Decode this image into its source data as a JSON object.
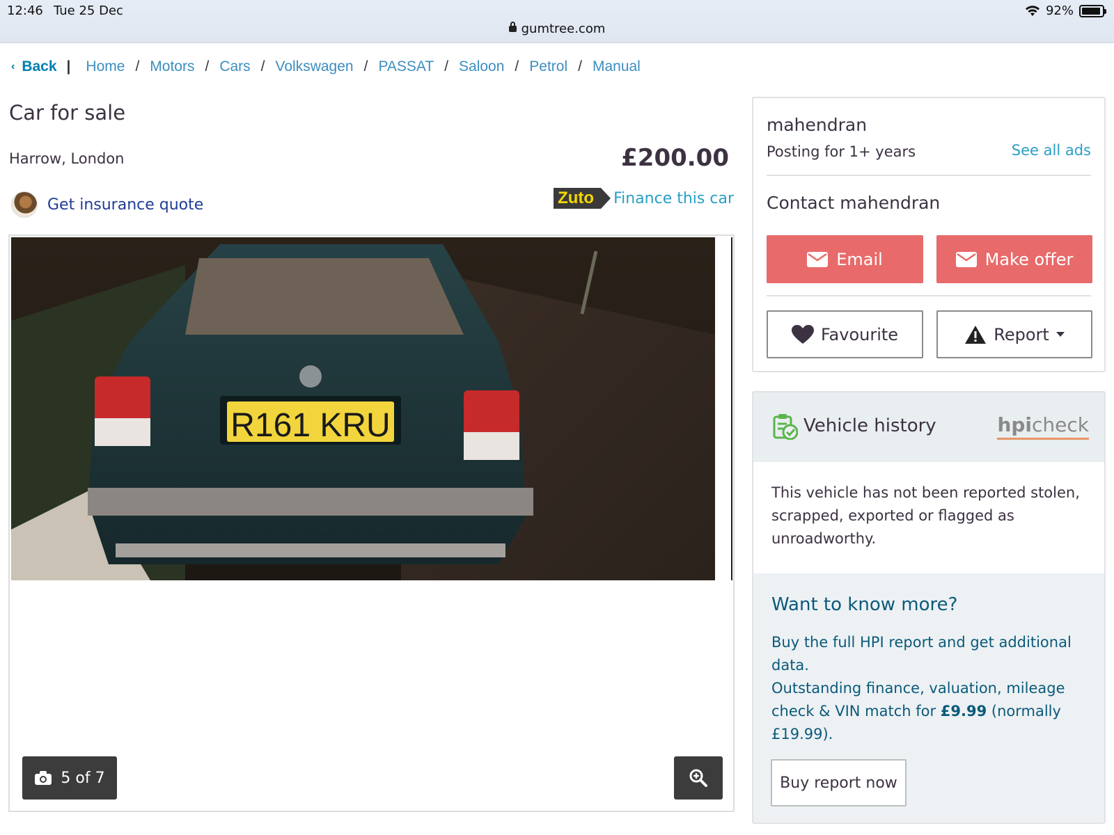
{
  "status_bar": {
    "time": "12:46",
    "date": "Tue 25 Dec",
    "battery_text": "92%",
    "battery_level": 0.92,
    "url": "gumtree.com"
  },
  "breadcrumb": {
    "back_label": "Back",
    "items": [
      "Home",
      "Motors",
      "Cars",
      "Volkswagen",
      "PASSAT",
      "Saloon",
      "Petrol",
      "Manual"
    ]
  },
  "listing": {
    "title": "Car for sale",
    "location": "Harrow, London",
    "price": "£200.00",
    "insurance_label": "Get insurance quote",
    "finance_brand": "Zuto",
    "finance_label": "Finance this car",
    "photo_counter": "5 of 7",
    "plate_text": "R161 KRU"
  },
  "seller": {
    "name": "mahendran",
    "posting_for": "Posting for 1+ years",
    "see_all_ads": "See all ads",
    "contact_heading": "Contact mahendran",
    "email_label": "Email",
    "make_offer_label": "Make offer",
    "favourite_label": "Favourite",
    "report_label": "Report"
  },
  "vehicle_history": {
    "title": "Vehicle history",
    "brand_bold": "hpi",
    "brand_light": "check",
    "status_text": "This vehicle has not been reported stolen, scrapped, exported or flagged as unroadworthy.",
    "more_title": "Want to know more?",
    "more_line1": "Buy the full HPI report and get additional data.",
    "more_line2_pre": "Outstanding finance, valuation, mileage check & VIN match for ",
    "more_price": "£9.99",
    "more_line2_post": " (normally £19.99).",
    "buy_label": "Buy report now"
  },
  "colors": {
    "link": "#2a9fc4",
    "accent_red": "#e86a6a",
    "hpi_teal": "#0b5a7a",
    "text": "#3c3241"
  }
}
